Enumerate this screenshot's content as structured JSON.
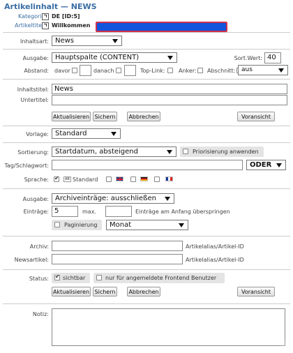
{
  "header": {
    "title": "Artikelinhalt — NEWS",
    "kategorie_label": "Kategorie:",
    "kategorie_value": "DE [ID:5]",
    "artikeltitel_label": "Artikeltitel:",
    "artikeltitel_value": "Willkommen"
  },
  "inhaltsart": {
    "label": "Inhaltsart:",
    "value": "News"
  },
  "ausgabe": {
    "label": "Ausgabe:",
    "value": "Hauptspalte (CONTENT)",
    "sort_label": "Sort.Wert:",
    "sort_value": "40"
  },
  "abstand": {
    "label": "Abstand:",
    "davor": "davor",
    "danach": "danach",
    "toplink": "Top-Link:",
    "anker": "Anker:",
    "abschnitt": "Abschnitt:",
    "abschnitt_value": "aus"
  },
  "titles": {
    "inhaltstitel_label": "Inhaltstitel:",
    "inhaltstitel_value": "News",
    "untertitel_label": "Untertitel:",
    "untertitel_value": ""
  },
  "buttons": {
    "aktualisieren": "Aktualisieren",
    "sichern": "Sichern",
    "abbrechen": "Abbrechen",
    "voransicht": "Voransicht"
  },
  "vorlage": {
    "label": "Vorlage:",
    "value": "Standard"
  },
  "sortierung": {
    "label": "Sortierung:",
    "value": "Startdatum, absteigend",
    "priorisierung": "Priorisierung anwenden"
  },
  "tags": {
    "label": "Tag/Schlagwort:",
    "value": "",
    "operator": "ODER"
  },
  "sprache": {
    "label": "Sprache:",
    "standard": "Standard",
    "ab_badge": "AB"
  },
  "ausgabe2": {
    "label": "Ausgabe:",
    "value": "Archiveinträge: ausschließen"
  },
  "eintraege": {
    "label": "Einträge:",
    "value": "5",
    "max_label": "max.",
    "skip_value": "",
    "skip_label": "Einträge am Anfang überspringen"
  },
  "paginierung": {
    "label": "Paginierung",
    "value": "Monat"
  },
  "archiv": {
    "label": "Archiv:",
    "value": "",
    "suffix": "Artikelalias/Artikel-ID"
  },
  "newsartikel": {
    "label": "Newsartikel:",
    "value": "",
    "suffix": "Artikelalias/Artikel-ID"
  },
  "status": {
    "label": "Status:",
    "sichtbar": "sichtbar",
    "frontend": "nur für angemeldete Frontend Benutzer"
  },
  "notiz": {
    "label": "Notiz:",
    "value": ""
  },
  "colors": {
    "title_blue": "#3a6ea5",
    "highlight_fill": "#1155dd",
    "highlight_border": "#d0304a"
  }
}
